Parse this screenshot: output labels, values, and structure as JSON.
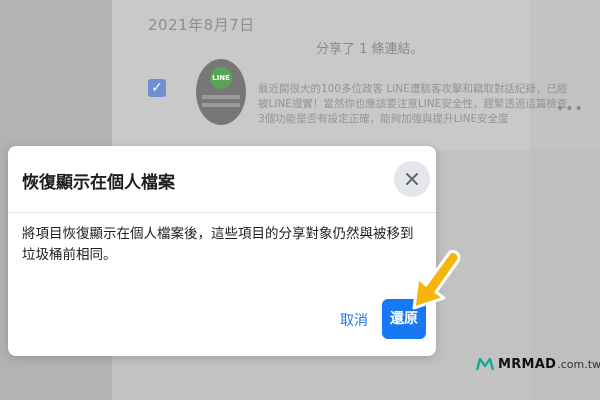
{
  "background": {
    "date": "2021年8月7日",
    "shared_text": "分享了 1 條連結。",
    "thumb_caption": "LINE",
    "description": "最近閱很大的100多位政客 LINE遭駭客攻擊和竊取對話紀錄，已經被LINE證實！當然你也應該要注意LINE安全性，趕緊透過這篇檢查 3個功能是否有設定正確，能夠加強與提升LINE安全度",
    "more": "•••"
  },
  "dialog": {
    "title": "恢復顯示在個人檔案",
    "body": "將項目恢復顯示在個人檔案後，這些項目的分享對象仍然與被移到垃圾桶前相同。",
    "cancel_label": "取消",
    "restore_label": "還原"
  },
  "watermark": {
    "brand": "MRMAD",
    "domain": ".com.tw"
  },
  "colors": {
    "primary": "#1877f2",
    "pointer": "#f5b50a"
  },
  "icons": {
    "close": "close-icon",
    "checkbox": "checkmark-icon",
    "pointer": "arrow-pointer-icon",
    "watermark": "mrmad-logo-icon"
  }
}
